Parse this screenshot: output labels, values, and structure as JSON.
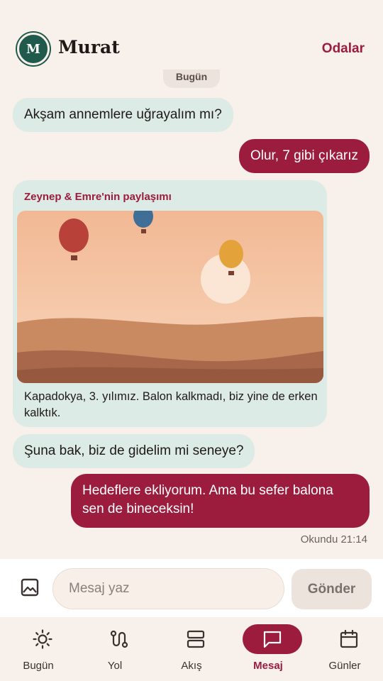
{
  "header": {
    "avatar_initial": "M",
    "contact_name": "Murat",
    "rooms_link": "Odalar"
  },
  "date_chip": "Bugün",
  "messages": [
    {
      "direction": "incoming",
      "text": "Akşam annemlere uğrayalım mı?"
    },
    {
      "direction": "outgoing",
      "text": "Olur, 7 gibi çıkarız"
    },
    {
      "direction": "incoming",
      "type": "share",
      "title": "Zeynep & Emre'nin paylaşımı",
      "caption": "Kapadokya, 3. yılımız. Balon kalkmadı, biz yine de erken kalktık."
    },
    {
      "direction": "incoming",
      "text": "Şuna bak, biz de gidelim mi seneye?"
    },
    {
      "direction": "outgoing",
      "text": "Hedeflere ekliyorum. Ama bu sefer balona sen de bineceksin!"
    }
  ],
  "read_receipt": "Okundu 21:14",
  "composer": {
    "attach_icon": "image-icon",
    "placeholder": "Mesaj yaz",
    "send_label": "Gönder"
  },
  "nav": {
    "items": [
      {
        "label": "Bugün",
        "icon": "sun-icon"
      },
      {
        "label": "Yol",
        "icon": "route-icon"
      },
      {
        "label": "Akış",
        "icon": "feed-icon"
      },
      {
        "label": "Mesaj",
        "icon": "message-icon",
        "active": true
      },
      {
        "label": "Günler",
        "icon": "calendar-icon"
      }
    ]
  },
  "colors": {
    "background": "#f8f0ea",
    "accent": "#9c1c3e",
    "incoming_bubble": "#dcebe6",
    "avatar": "#1f5a4c"
  }
}
